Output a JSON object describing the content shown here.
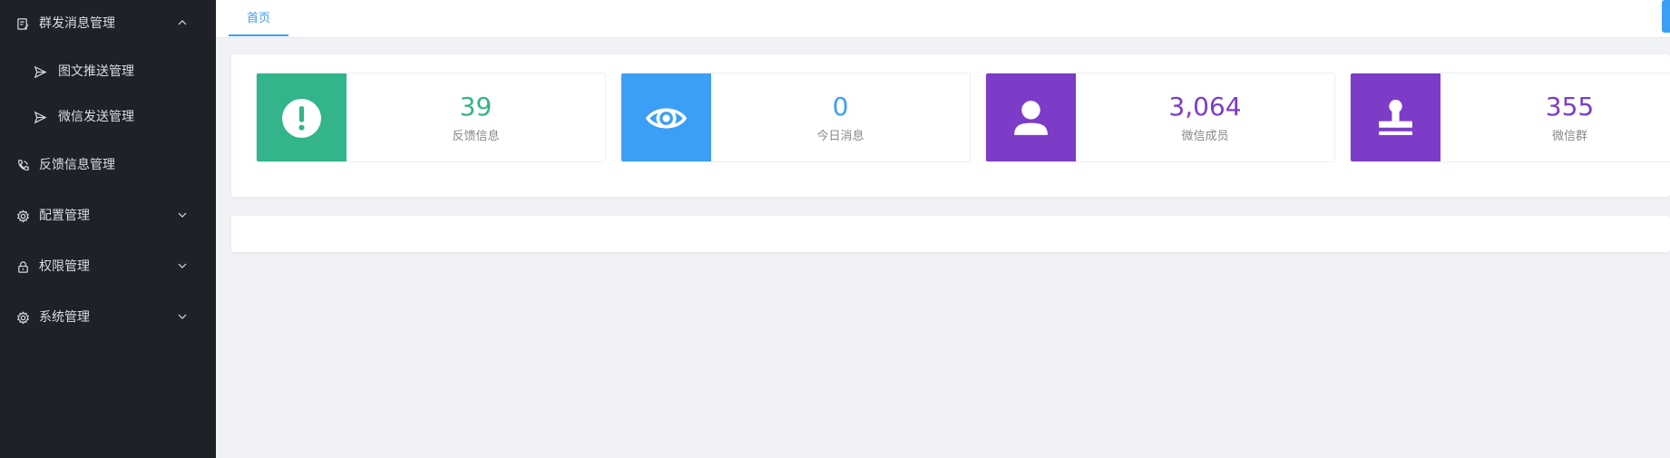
{
  "sidebar": {
    "items": [
      {
        "label": "群发消息管理",
        "icon": "message-list-icon",
        "expanded": true
      },
      {
        "label": "图文推送管理",
        "icon": "send-icon",
        "sub": true
      },
      {
        "label": "微信发送管理",
        "icon": "send-icon",
        "sub": true
      },
      {
        "label": "反馈信息管理",
        "icon": "phone-icon"
      },
      {
        "label": "配置管理",
        "icon": "gear-icon",
        "expanded": false
      },
      {
        "label": "权限管理",
        "icon": "lock-icon",
        "expanded": false
      },
      {
        "label": "系统管理",
        "icon": "gear-icon",
        "expanded": false
      }
    ]
  },
  "tabs": [
    {
      "label": "首页",
      "active": true
    }
  ],
  "cards": [
    {
      "value": "39",
      "caption": "反馈信息",
      "color": "#33b48b",
      "icon": "exclamation-circle-icon"
    },
    {
      "value": "0",
      "caption": "今日消息",
      "color": "#3a9ff5",
      "icon": "eye-icon"
    },
    {
      "value": "3,064",
      "caption": "微信成员",
      "color": "#7c3cc8",
      "icon": "user-icon"
    },
    {
      "value": "355",
      "caption": "微信群",
      "color": "#7c3cc8",
      "icon": "stamp-icon"
    }
  ],
  "colors": {
    "sidebar_bg": "#1f2128",
    "accent": "#3a9ff5",
    "green": "#33b48b",
    "purple": "#7c3cc8"
  }
}
